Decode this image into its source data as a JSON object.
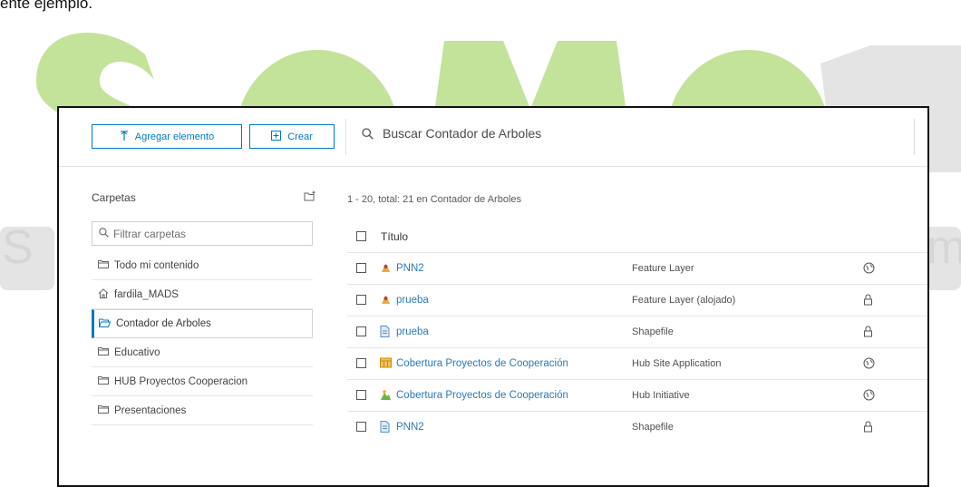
{
  "page": {
    "caption": "ente ejemplo.",
    "watermark_text": "SOMOSIG",
    "watermark_sub_left": "S",
    "watermark_sub_right": "m"
  },
  "colors": {
    "accent": "#0079c1",
    "link": "#2b7ab8",
    "watermark_green": "#c3e29a",
    "watermark_gray": "#e4e4e4"
  },
  "toolbar": {
    "add_label": "Agregar elemento",
    "add_icon": "upload-icon",
    "create_label": "Crear",
    "create_icon": "plus-square-icon",
    "search_placeholder": "Buscar Contador de Arboles",
    "search_icon": "search-icon"
  },
  "sidebar": {
    "heading": "Carpetas",
    "new_folder_icon": "new-folder-icon",
    "filter_placeholder": "Filtrar carpetas",
    "folders": [
      {
        "label": "Todo mi contenido",
        "icon": "folders-icon",
        "active": false
      },
      {
        "label": "fardila_MADS",
        "icon": "home-icon",
        "active": false
      },
      {
        "label": "Contador de Arboles",
        "icon": "folder-open-icon",
        "active": true
      },
      {
        "label": "Educativo",
        "icon": "folder-icon",
        "active": false
      },
      {
        "label": "HUB Proyectos Cooperacion",
        "icon": "folder-icon",
        "active": false
      },
      {
        "label": "Presentaciones",
        "icon": "folder-icon",
        "active": false
      }
    ]
  },
  "content": {
    "count_text": "1 - 20, total: 21 en Contador de Arboles",
    "column_title": "Título",
    "items": [
      {
        "title": "PNN2",
        "type": "Feature Layer",
        "item_icon": "feature-layer-icon",
        "sharing": "globe-icon"
      },
      {
        "title": "prueba",
        "type": "Feature Layer (alojado)",
        "item_icon": "feature-layer-icon",
        "sharing": "lock-icon"
      },
      {
        "title": "prueba",
        "type": "Shapefile",
        "item_icon": "file-icon",
        "sharing": "lock-icon"
      },
      {
        "title": "Cobertura Proyectos de Cooperación",
        "type": "Hub Site Application",
        "item_icon": "hub-site-icon",
        "sharing": "globe-icon"
      },
      {
        "title": "Cobertura Proyectos de Cooperación",
        "type": "Hub Initiative",
        "item_icon": "hub-initiative-icon",
        "sharing": "globe-icon"
      },
      {
        "title": "PNN2",
        "type": "Shapefile",
        "item_icon": "file-icon",
        "sharing": "lock-icon"
      }
    ]
  }
}
